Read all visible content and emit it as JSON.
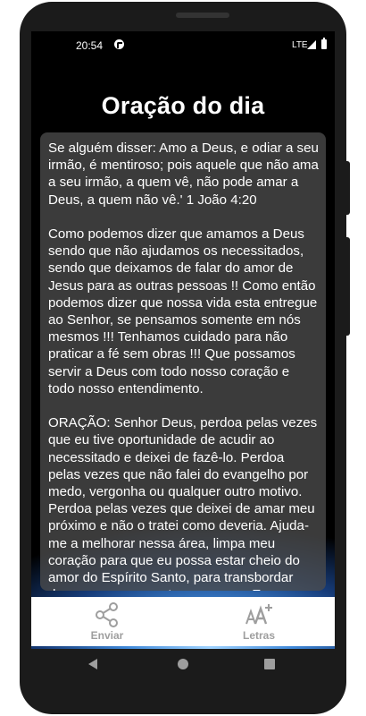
{
  "status_bar": {
    "time": "20:54",
    "network": "LTE",
    "icons": [
      "app-notification-icon",
      "signal-icon",
      "battery-icon"
    ]
  },
  "page": {
    "title": "Oração do dia"
  },
  "prayer": {
    "paragraphs": [
      "Se alguém disser: Amo a Deus, e odiar a seu irmão, é mentiroso; pois aquele que não ama a seu irmão, a quem vê, não pode amar a Deus, a quem não vê.' 1 João 4:20",
      "Como podemos dizer que amamos a Deus sendo que não ajudamos os necessitados, sendo que deixamos de falar do amor de Jesus para as outras pessoas !! Como então podemos dizer que nossa vida esta entregue ao Senhor, se pensamos somente em nós mesmos !!! Tenhamos cuidado para não praticar a fé sem obras !!! Que possamos servir a Deus com todo nosso coração e todo nosso entendimento.",
      "ORAÇÃO: Senhor Deus, perdoa pelas vezes que eu tive oportunidade de acudir ao necessitado e deixei de fazê-lo. Perdoa pelas vezes que não falei do evangelho por medo, vergonha ou qualquer outro motivo. Perdoa pelas vezes que deixei de amar meu próximo e não o tratei como deveria. Ajuda-me a melhorar nessa área, limpa meu coração para que eu possa estar cheio do amor do Espírito Santo, para transbordar desse amor para outras pessoas. Eu oro em nome de Jesus."
    ]
  },
  "bottom_bar": {
    "share_label": "Enviar",
    "font_label": "Letras",
    "share_icon": "share-icon",
    "font_icon": "font-size-icon"
  },
  "colors": {
    "card_background": "#4b4b4b",
    "bottom_bar_text": "#9e9e9e",
    "title_text": "#ffffff"
  }
}
